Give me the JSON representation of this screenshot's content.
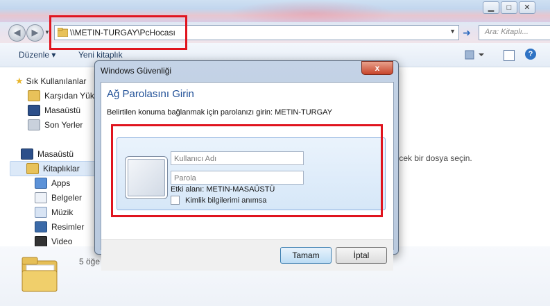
{
  "explorer": {
    "address": "\\\\METIN-TURGAY\\PcHocası",
    "search_placeholder": "Ara: Kitaplı...",
    "toolbar": {
      "organize": "Düzenle",
      "new_library": "Yeni kitaplık"
    },
    "nav": {
      "favorites_header": "Sık Kullanılanlar",
      "favorites": [
        "Karşıdan Yükle",
        "Masaüstü",
        "Son Yerler"
      ],
      "desktop_header": "Masaüstü",
      "libraries": "Kitaplıklar",
      "library_items": [
        "Apps",
        "Belgeler",
        "Müzik",
        "Resimler",
        "Video"
      ]
    },
    "empty_pane_text": "ıcek bir dosya seçin.",
    "item_count": "5 öğe"
  },
  "dialog": {
    "title": "Windows Güvenliği",
    "close_label": "x",
    "heading": "Ağ Parolasını Girin",
    "description": "Belirtilen konuma bağlanmak için parolanızı girin: METIN-TURGAY",
    "username_placeholder": "Kullanıcı Adı",
    "password_placeholder": "Parola",
    "domain_label": "Etki alanı: METIN-MASAÜSTÜ",
    "remember_label": "Kimlik bilgilerimi anımsa",
    "ok_label": "Tamam",
    "cancel_label": "İptal"
  },
  "colors": {
    "highlight_red": "#e0141e",
    "heading_blue": "#1e4e96"
  }
}
